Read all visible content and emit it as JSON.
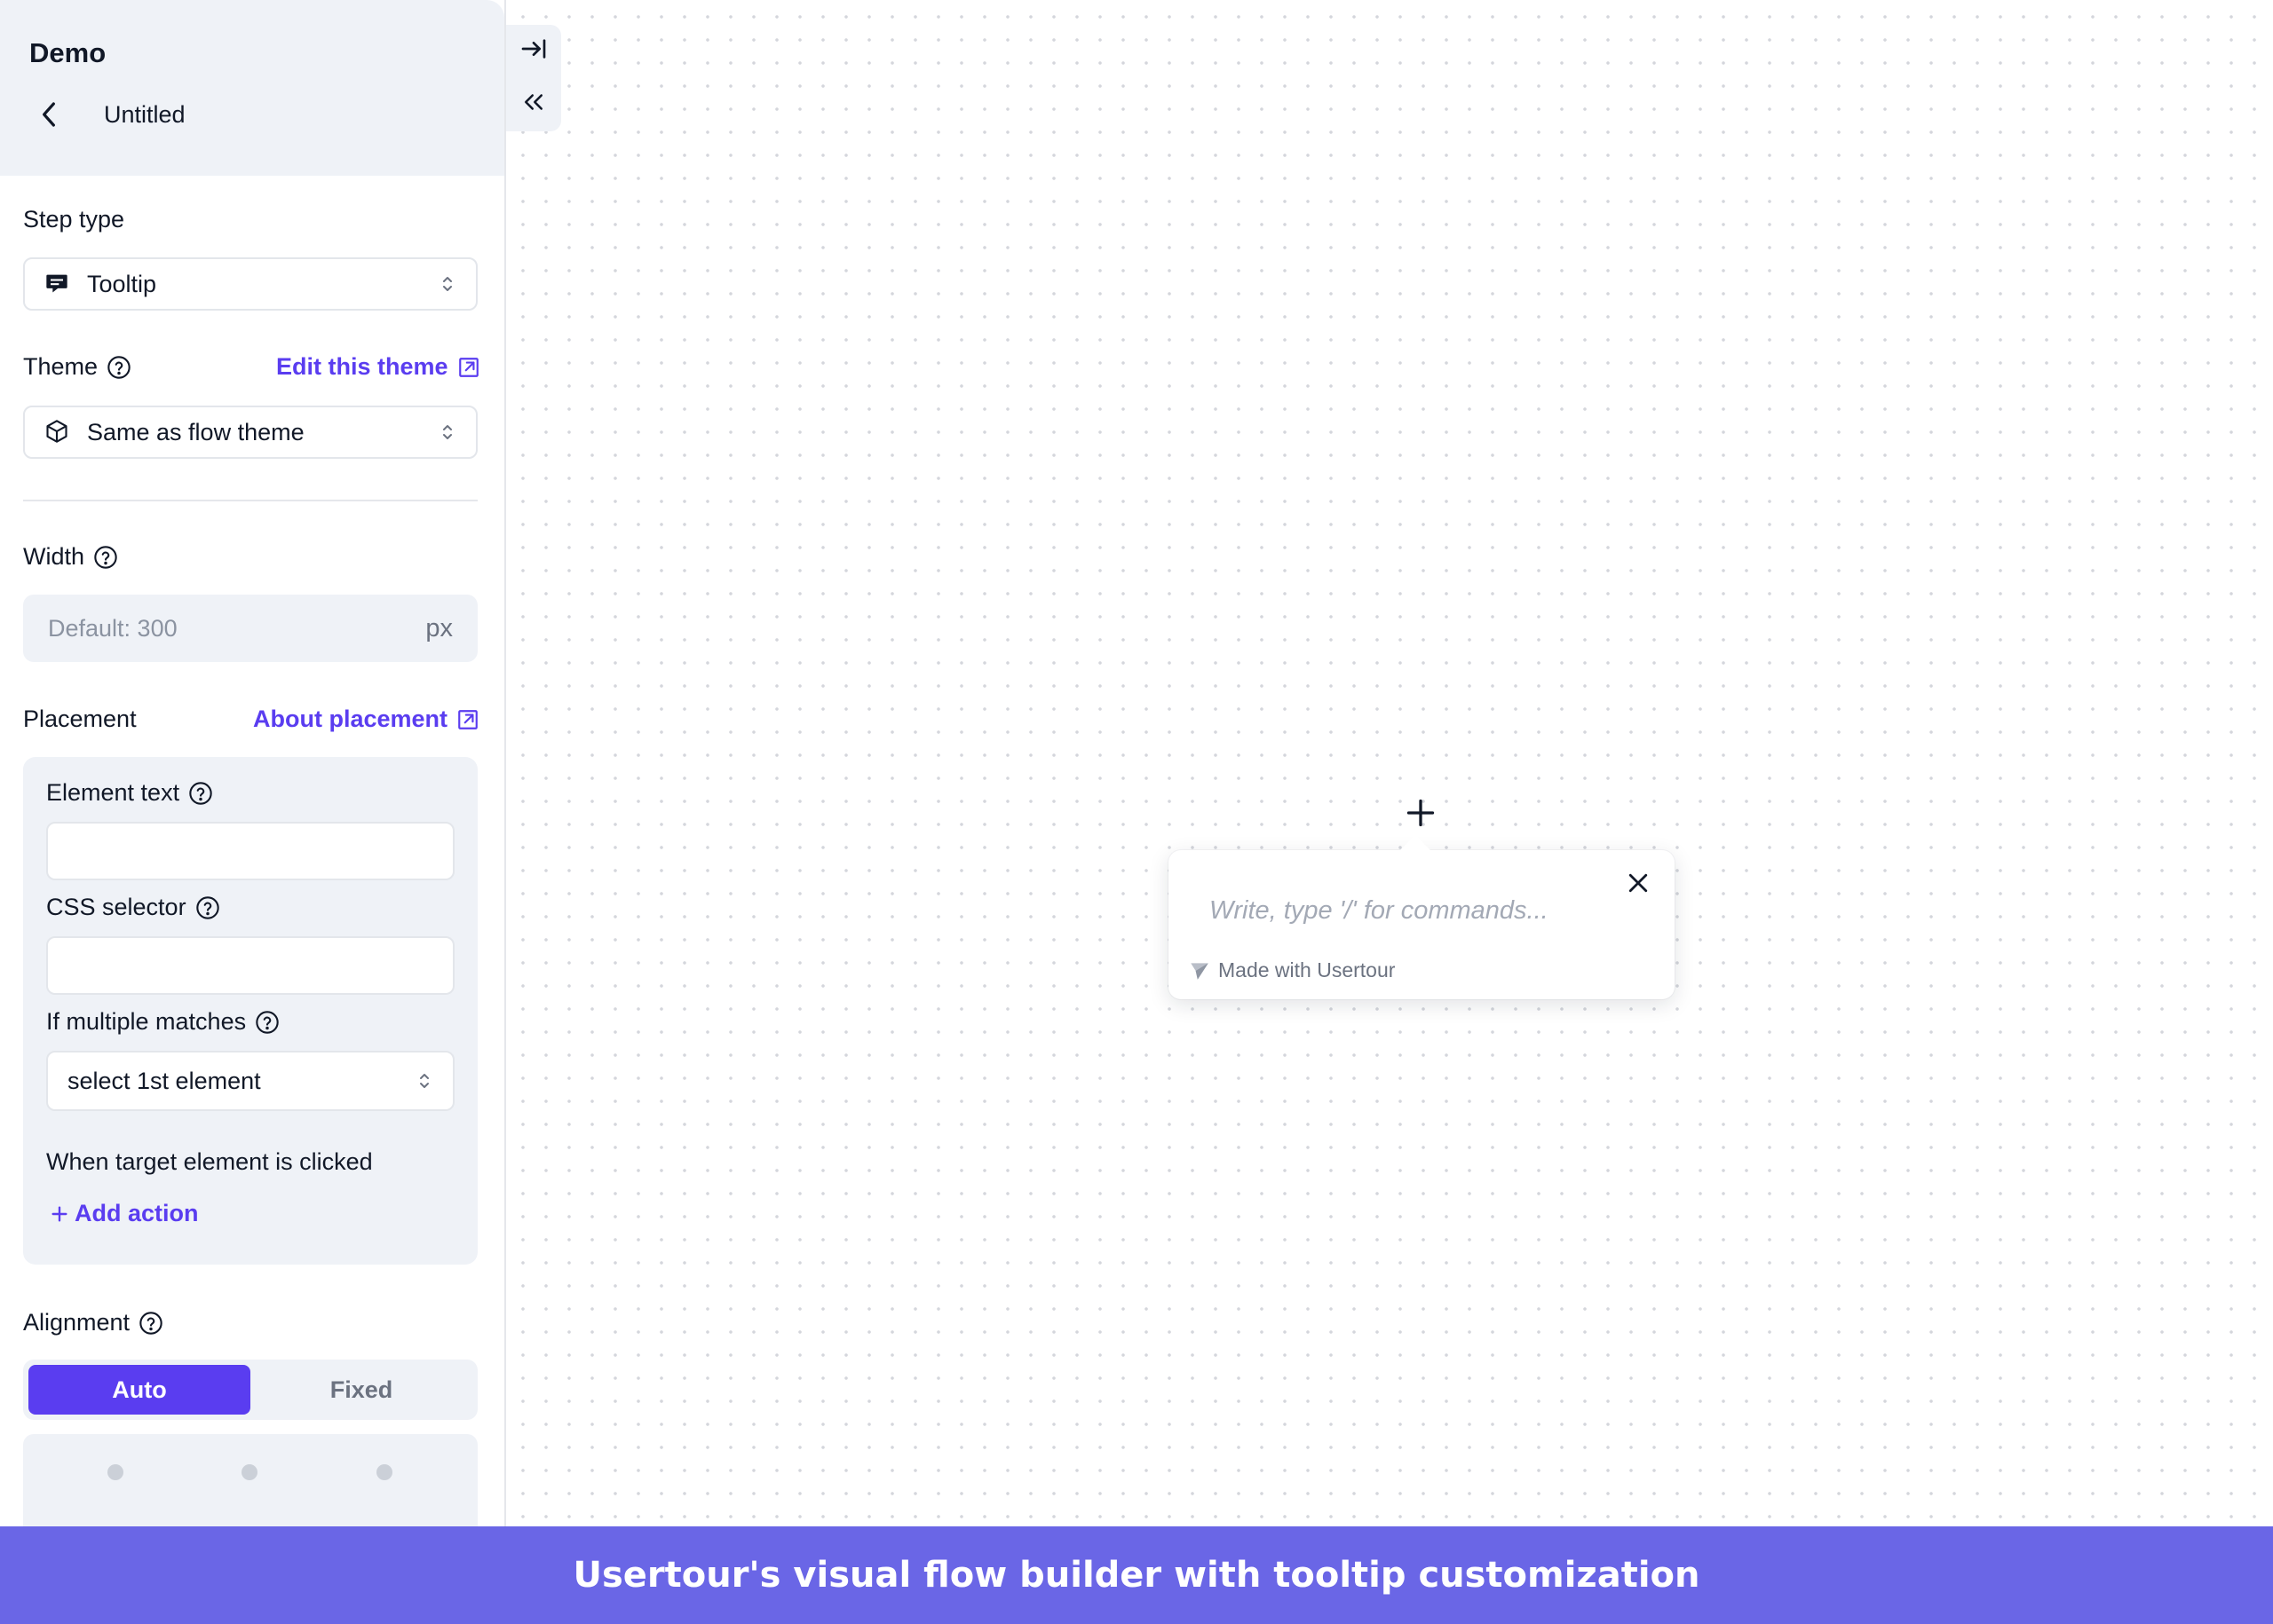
{
  "app": {
    "name": "Demo",
    "flow_title": "Untitled"
  },
  "step_type": {
    "label": "Step type",
    "value": "Tooltip"
  },
  "theme": {
    "label": "Theme",
    "edit_link": "Edit this theme",
    "value": "Same as flow theme"
  },
  "width": {
    "label": "Width",
    "placeholder": "Default: 300",
    "unit": "px"
  },
  "placement": {
    "label": "Placement",
    "about_link": "About placement",
    "element_text_label": "Element text",
    "css_selector_label": "CSS selector",
    "multiple_matches_label": "If multiple matches",
    "multiple_matches_value": "select 1st element",
    "target_clicked_label": "When target element is clicked",
    "add_action": "Add action"
  },
  "alignment": {
    "label": "Alignment",
    "options": [
      "Auto",
      "Fixed"
    ],
    "selected": "Auto"
  },
  "tooltip": {
    "placeholder": "Write, type '/' for commands...",
    "branding": "Made with Usertour"
  },
  "caption": "Usertour's visual flow builder with tooltip customization",
  "colors": {
    "accent": "#5a3df0",
    "panel_bg": "#eff2f7",
    "banner": "#6a66e6"
  }
}
